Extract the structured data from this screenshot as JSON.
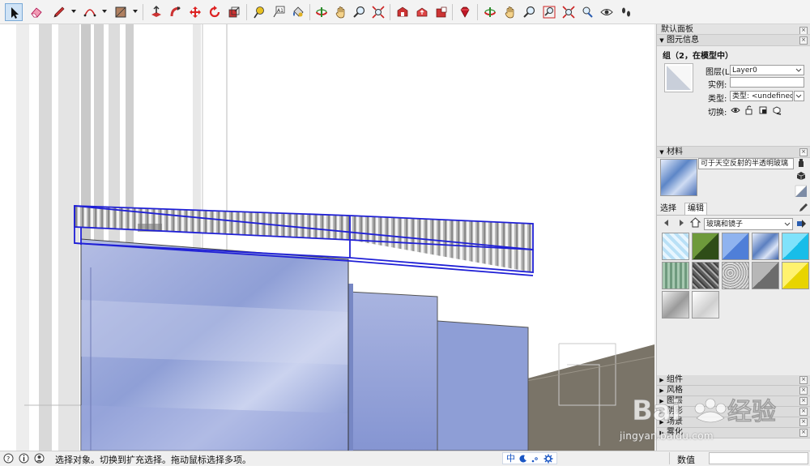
{
  "toolbar": {
    "buttons": [
      {
        "name": "select-tool",
        "icon": "arrow-cursor-icon",
        "active": true
      },
      {
        "name": "eraser-tool",
        "icon": "eraser-icon"
      },
      {
        "name": "line-tool",
        "icon": "pencil-icon"
      },
      {
        "name": "arc-tool",
        "icon": "arc-icon"
      },
      {
        "name": "rectangle-tool",
        "icon": "rectangle-icon"
      },
      {
        "name": "push-pull-tool",
        "icon": "push-pull-icon"
      },
      {
        "name": "follow-me-tool",
        "icon": "follow-me-icon"
      },
      {
        "name": "move-tool",
        "icon": "move-icon"
      },
      {
        "name": "rotate-tool",
        "icon": "rotate-icon"
      },
      {
        "name": "scale-tool",
        "icon": "scale-icon"
      },
      {
        "name": "tape-measure-tool",
        "icon": "tape-measure-icon"
      },
      {
        "name": "text-tool",
        "icon": "text-icon"
      },
      {
        "name": "paint-bucket-tool",
        "icon": "paint-bucket-icon"
      },
      {
        "name": "orbit-tool",
        "icon": "orbit-icon"
      },
      {
        "name": "pan-tool",
        "icon": "pan-hand-icon"
      },
      {
        "name": "zoom-tool",
        "icon": "zoom-icon"
      },
      {
        "name": "zoom-extents-tool",
        "icon": "zoom-extents-icon"
      },
      {
        "name": "warehouse-button",
        "icon": "warehouse-icon"
      },
      {
        "name": "share-model-button",
        "icon": "share-model-icon"
      },
      {
        "name": "extension-warehouse-button",
        "icon": "extension-icon"
      },
      {
        "name": "ruby-console-button",
        "icon": "ruby-icon"
      },
      {
        "name": "orbit-tool-2",
        "icon": "orbit-icon"
      },
      {
        "name": "pan-tool-2",
        "icon": "pan-hand-icon"
      },
      {
        "name": "zoom-tool-2",
        "icon": "zoom-icon"
      },
      {
        "name": "zoom-window-tool",
        "icon": "zoom-window-icon"
      },
      {
        "name": "zoom-extents-tool-2",
        "icon": "zoom-extents-icon"
      },
      {
        "name": "position-camera-tool",
        "icon": "position-camera-icon"
      },
      {
        "name": "look-around-tool",
        "icon": "eye-icon"
      },
      {
        "name": "walk-tool",
        "icon": "footprints-icon"
      }
    ]
  },
  "tray": {
    "title": "默认面板",
    "entity_info": {
      "header": "图元信息",
      "entity_name": "组（2，在模型中）",
      "layer_label": "图层(L):",
      "layer_value": "Layer0",
      "instance_label": "实例:",
      "instance_value": "",
      "type_label": "类型:",
      "type_value": "类型: <undefined>",
      "toggle_label": "切换:"
    },
    "materials": {
      "header": "材料",
      "material_name": "可于天空反射的半透明玻璃",
      "tab_select": "选择",
      "tab_edit": "编辑",
      "library_value": "玻璃和镜子",
      "swatches": [
        {
          "name": "blue-glass-tile",
          "color": "#bfe3f5"
        },
        {
          "name": "green-glass",
          "color": "#4f7a2d"
        },
        {
          "name": "blue-glass",
          "color": "#5f8fe0"
        },
        {
          "name": "sky-reflect-glass",
          "color": "#8aa6cf"
        },
        {
          "name": "cyan-glass",
          "color": "#2ec7f0"
        },
        {
          "name": "green-striped-glass",
          "color": "#8fb79e"
        },
        {
          "name": "patterned-glass",
          "color": "#7f7f7f"
        },
        {
          "name": "frosted-glass",
          "color": "#b9b9b9"
        },
        {
          "name": "gray-glass",
          "color": "#8e8e8e"
        },
        {
          "name": "yellow-glass",
          "color": "#f0e030"
        },
        {
          "name": "mirror",
          "color": "#bdbdbd"
        },
        {
          "name": "light-mirror",
          "color": "#e2e2e2"
        }
      ]
    },
    "collapsed_panels": [
      "组件",
      "风格",
      "图层",
      "阴影",
      "场景",
      "雾化"
    ]
  },
  "status": {
    "text": "选择对象。切换到扩充选择。拖动鼠标选择多项。",
    "ime_label": "中",
    "measurements_label": "数值",
    "measurements_value": ""
  },
  "watermark": {
    "brand": "Baidu经验",
    "url": "jingyan.baidu.com"
  },
  "colors": {
    "selection_blue": "#1f1fd6",
    "glass_blue": "#8e9ed6",
    "ground": "#7a7468"
  }
}
